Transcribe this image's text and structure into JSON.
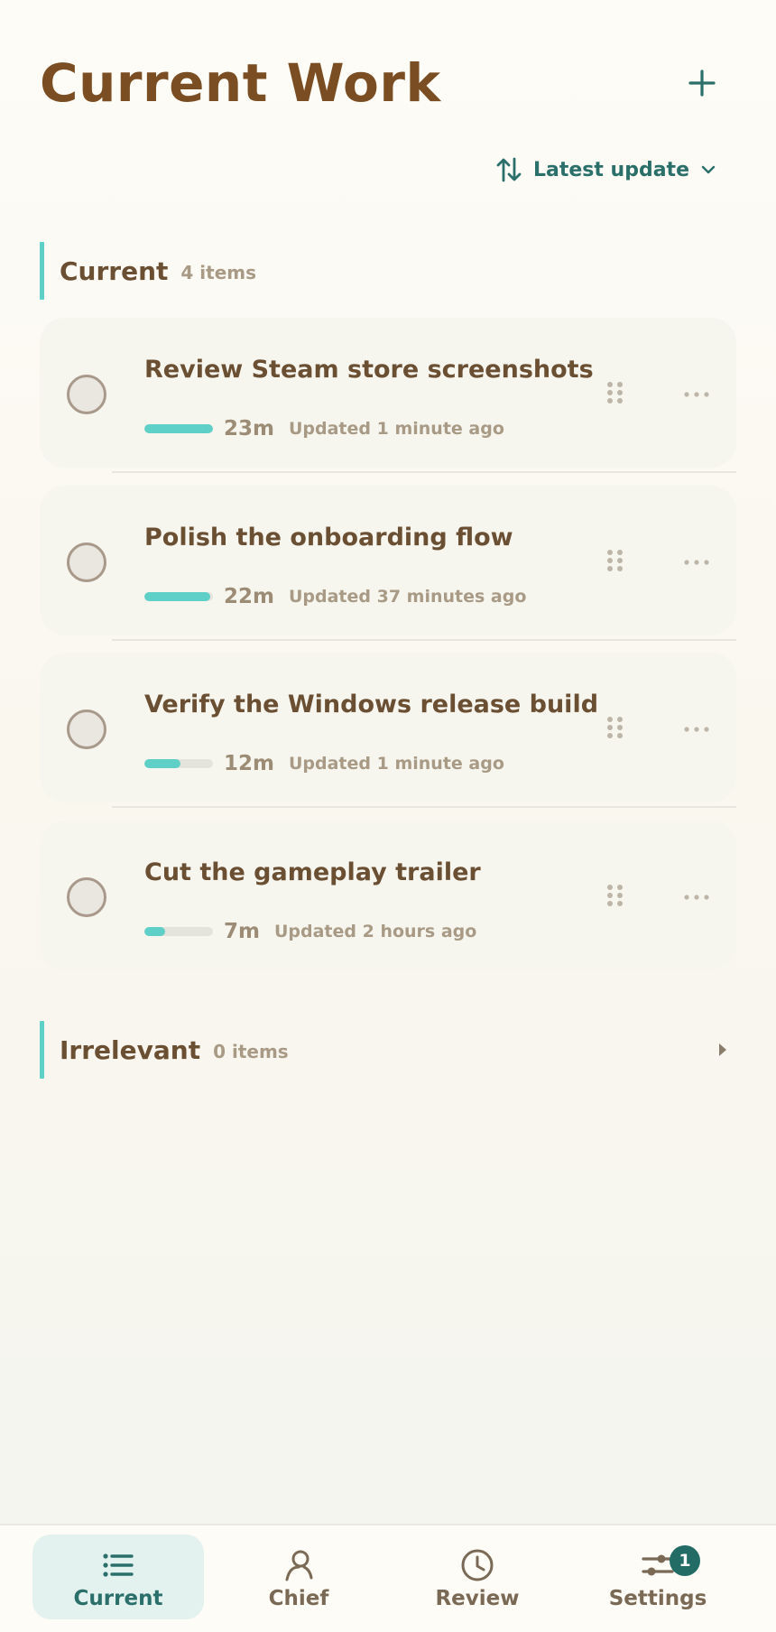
{
  "header": {
    "title": "Current Work"
  },
  "sort": {
    "label": "Latest update"
  },
  "sections": [
    {
      "title": "Current",
      "count": "4 items"
    },
    {
      "title": "Irrelevant",
      "count": "0 items"
    }
  ],
  "tasks": [
    {
      "title": "Review Steam store screenshots",
      "duration": "23m",
      "updated": "Updated 1 minute ago",
      "progress": 1.0
    },
    {
      "title": "Polish the onboarding flow",
      "duration": "22m",
      "updated": "Updated 37 minutes ago",
      "progress": 0.96
    },
    {
      "title": "Verify the Windows release build",
      "duration": "12m",
      "updated": "Updated 1 minute ago",
      "progress": 0.52
    },
    {
      "title": "Cut the gameplay trailer",
      "duration": "7m",
      "updated": "Updated 2 hours ago",
      "progress": 0.3
    }
  ],
  "tabs": [
    {
      "label": "Current",
      "icon": "list-icon",
      "active": true
    },
    {
      "label": "Chief",
      "icon": "person-icon"
    },
    {
      "label": "Review",
      "icon": "clock-icon"
    },
    {
      "label": "Settings",
      "icon": "sliders-icon",
      "badge": "1"
    }
  ],
  "colors": {
    "accent": "#5fd0c7",
    "primary": "#2b6f6a",
    "title": "#7a4e22",
    "text": "#6b4f33",
    "muted": "#a89a85"
  }
}
